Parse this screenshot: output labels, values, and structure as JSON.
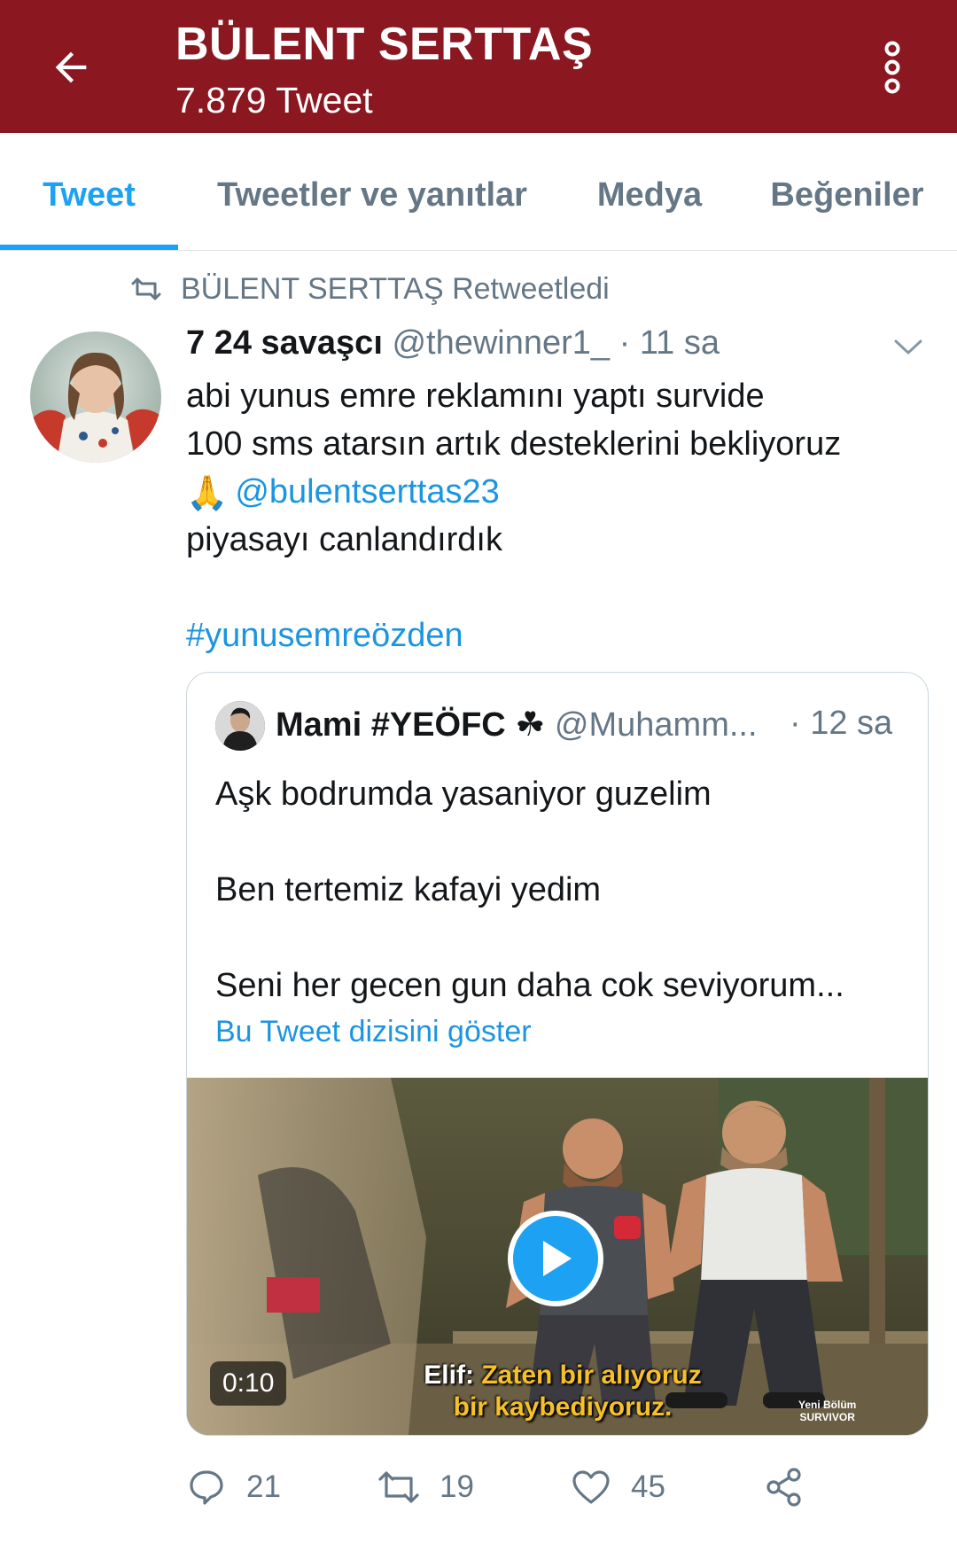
{
  "header": {
    "title": "BÜLENT SERTTAŞ",
    "subtitle": "7.879 Tweet",
    "back_icon": "arrow-left-icon",
    "more_icon": "vertical-dots-icon"
  },
  "tabs": [
    {
      "label": "Tweet",
      "active": true
    },
    {
      "label": "Tweetler ve yanıtlar",
      "active": false
    },
    {
      "label": "Medya",
      "active": false
    },
    {
      "label": "Beğeniler",
      "active": false
    }
  ],
  "retweet_label": "BÜLENT SERTTAŞ Retweetledi",
  "tweet": {
    "author_name": "7 24 savaşcı",
    "handle": "@thewinner1_",
    "time": "· 11 sa",
    "lines": [
      "abi yunus emre reklamını yaptı survide",
      "100 sms atarsın artık desteklerini bekliyoruz"
    ],
    "emoji": "🙏",
    "mention": "@bulentserttas23",
    "line4": "piyasayı canlandırdık",
    "hashtag": "#yunusemreözden"
  },
  "quote": {
    "name": "Mami #YEÖFC ☘",
    "handle": "@Muhamm...",
    "time": "· 12 sa",
    "lines": [
      "Aşk bodrumda yasaniyor guzelim",
      "",
      "Ben tertemiz kafayi yedim",
      "",
      "Seni her gecen gun daha cok seviyorum..."
    ],
    "thread_link": "Bu Tweet dizisini göster",
    "video": {
      "duration": "0:10",
      "caption_speaker": "Elif:",
      "caption_line1": "Zaten bir alıyoruz",
      "caption_line2": "bir kaybediyoruz.",
      "watermark_line1": "Yeni Bölüm",
      "watermark_line2": "SURVIVOR"
    }
  },
  "actions": {
    "reply_count": "21",
    "retweet_count": "19",
    "like_count": "45"
  },
  "colors": {
    "header_bg": "#8b1720",
    "accent": "#1da1f2",
    "secondary_text": "#657786"
  }
}
